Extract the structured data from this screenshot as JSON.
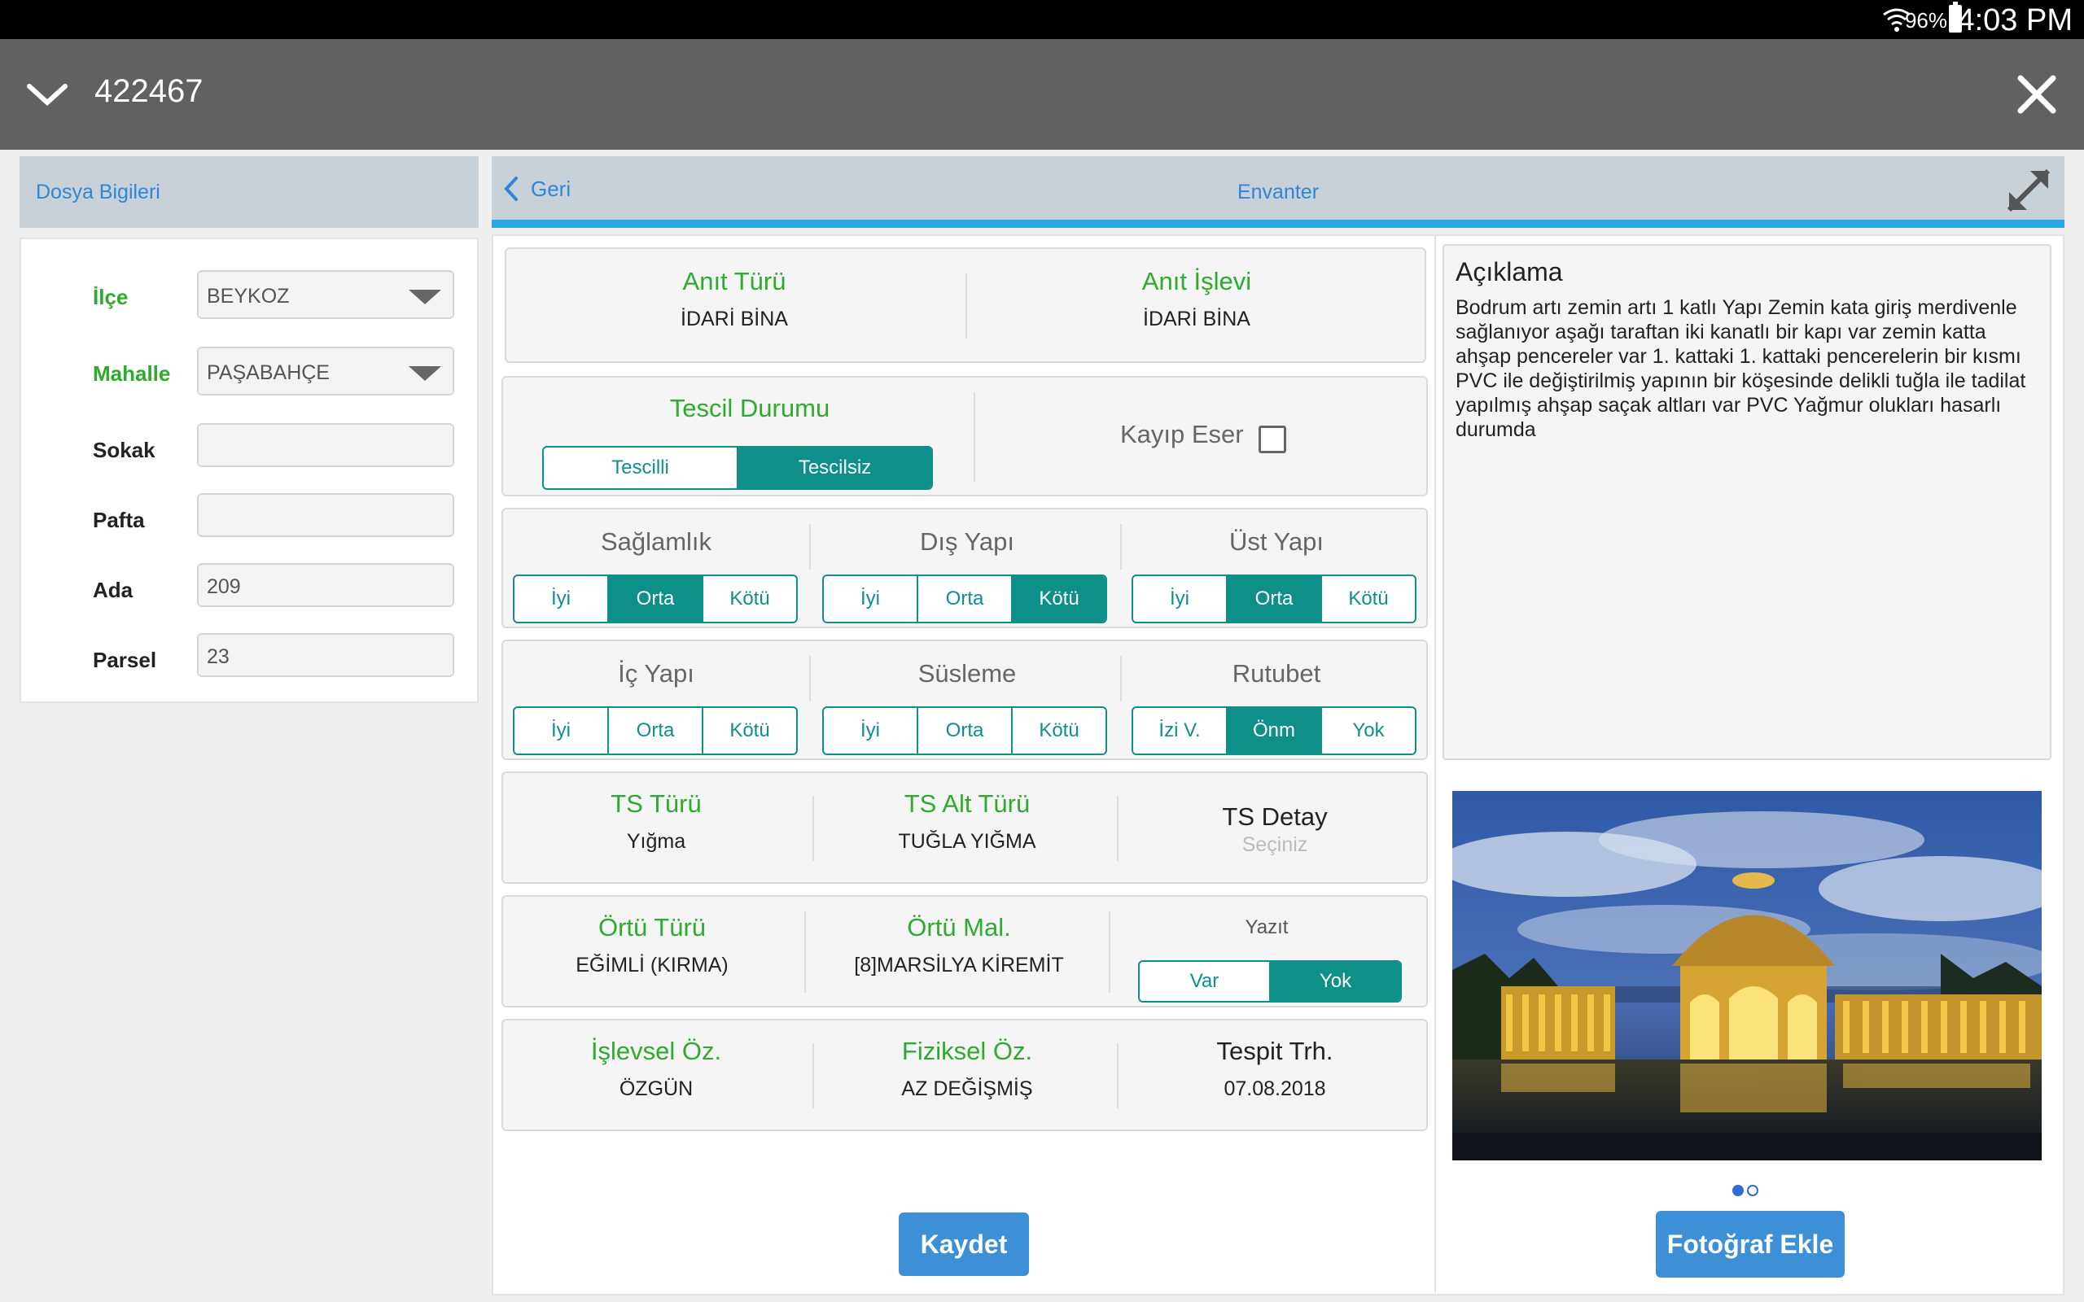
{
  "status": {
    "battery": "96%",
    "time": "4:03 PM"
  },
  "appbar": {
    "title": "422467"
  },
  "left": {
    "header": "Dosya Bigileri",
    "fields": [
      {
        "label": "İlçe",
        "value": "BEYKOZ"
      },
      {
        "label": "Mahalle",
        "value": "PAŞABAHÇE"
      },
      {
        "label": "Sokak",
        "value": ""
      },
      {
        "label": "Pafta",
        "value": ""
      },
      {
        "label": "Ada",
        "value": "209"
      },
      {
        "label": "Parsel",
        "value": "23"
      }
    ]
  },
  "right": {
    "back_label": "Geri",
    "title": "Envanter"
  },
  "anit": {
    "turu_label": "Anıt Türü",
    "turu_value": "İDARİ BİNA",
    "islevi_label": "Anıt İşlevi",
    "islevi_value": "İDARİ BİNA"
  },
  "tescil": {
    "label": "Tescil Durumu",
    "options": [
      "Tescilli",
      "Tescilsiz"
    ],
    "kayip_label": "Kayıp Eser"
  },
  "condition1": {
    "saglamlik": {
      "label": "Sağlamlık",
      "options": [
        "İyi",
        "Orta",
        "Kötü"
      ]
    },
    "dis_yapi": {
      "label": "Dış Yapı",
      "options": [
        "İyi",
        "Orta",
        "Kötü"
      ]
    },
    "ust_yapi": {
      "label": "Üst Yapı",
      "options": [
        "İyi",
        "Orta",
        "Kötü"
      ]
    }
  },
  "condition2": {
    "ic_yapi": {
      "label": "İç Yapı",
      "options": [
        "İyi",
        "Orta",
        "Kötü"
      ]
    },
    "susleme": {
      "label": "Süsleme",
      "options": [
        "İyi",
        "Orta",
        "Kötü"
      ]
    },
    "rutubet": {
      "label": "Rutubet",
      "options": [
        "İzi V.",
        "Önm",
        "Yok"
      ]
    }
  },
  "ts": {
    "turu_label": "TS Türü",
    "turu_value": "Yığma",
    "alt_label": "TS Alt Türü",
    "alt_value": "TUĞLA YIĞMA",
    "detay_label": "TS Detay",
    "detay_placeholder": "Seçiniz"
  },
  "ortu": {
    "turu_label": "Örtü Türü",
    "turu_value": "EĞİMLİ (KIRMA)",
    "mal_label": "Örtü Mal.",
    "mal_value": "[8]MARSİLYA KİREMİT",
    "yazit_label": "Yazıt",
    "yazit_options": [
      "Var",
      "Yok"
    ]
  },
  "oz": {
    "islevsel_label": "İşlevsel Öz.",
    "islevsel_value": "ÖZGÜN",
    "fiziksel_label": "Fiziksel Öz.",
    "fiziksel_value": "AZ DEĞİŞMİŞ",
    "tespit_label": "Tespit Trh.",
    "tespit_value": "07.08.2018"
  },
  "aciklama": {
    "title": "Açıklama",
    "text": "Bodrum artı zemin artı 1 katlı Yapı Zemin kata giriş merdivenle sağlanıyor aşağı taraftan iki kanatlı bir kapı var zemin katta ahşap pencereler var 1. kattaki 1. kattaki pencerelerin bir kısmı PVC ile değiştirilmiş yapının bir köşesinde delikli tuğla ile tadilat yapılmış ahşap saçak altları var PVC Yağmur olukları hasarlı durumda"
  },
  "buttons": {
    "save": "Kaydet",
    "add_photo": "Fotoğraf Ekle"
  },
  "colors": {
    "accent": "#0f8f8a",
    "green": "#2eaa2e",
    "blue": "#3d8fd6",
    "appbar": "#616161"
  }
}
